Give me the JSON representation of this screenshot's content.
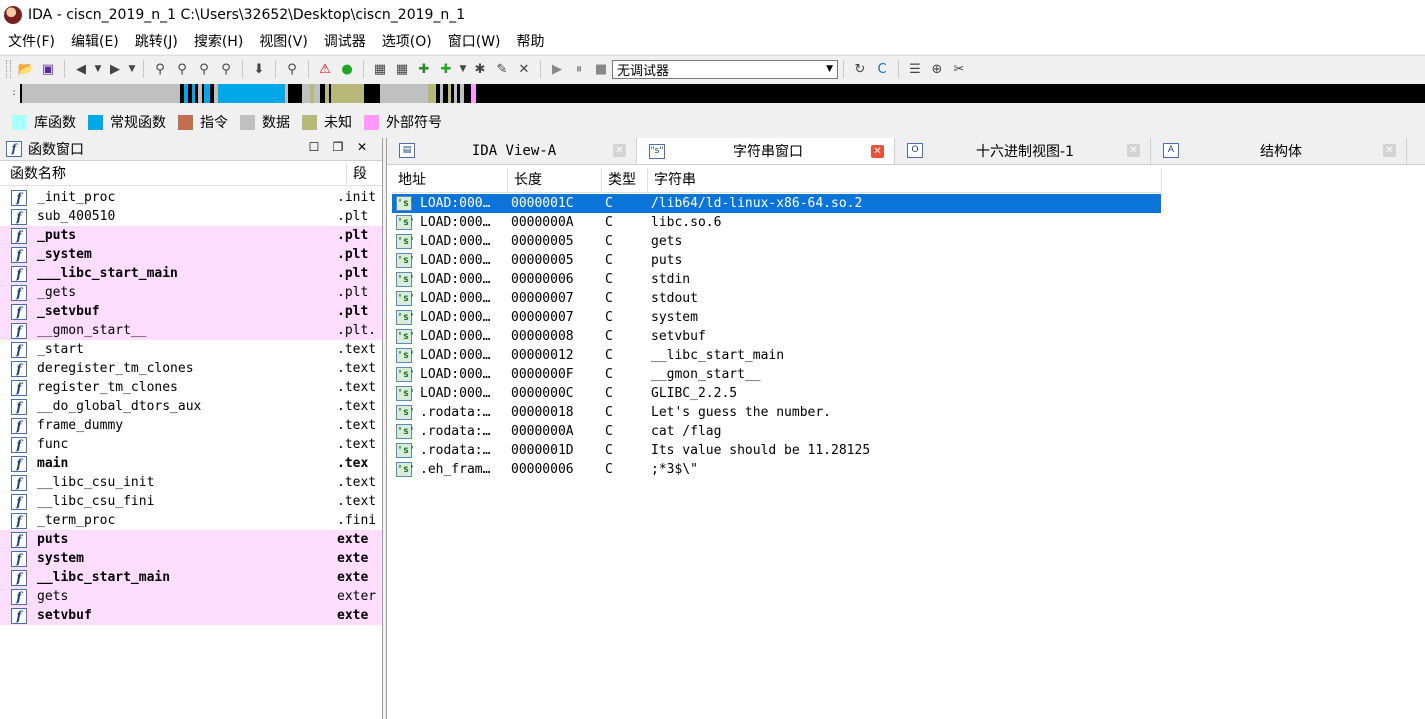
{
  "window": {
    "title": "IDA - ciscn_2019_n_1 C:\\Users\\32652\\Desktop\\ciscn_2019_n_1"
  },
  "menu": [
    "文件(F)",
    "编辑(E)",
    "跳转(J)",
    "搜索(H)",
    "视图(V)",
    "调试器",
    "选项(O)",
    "窗口(W)",
    "帮助"
  ],
  "toolbar": {
    "debugger_selected": "无调试器",
    "icons": [
      "open-icon",
      "save-icon",
      "back-icon",
      "forward-icon",
      "search-icon",
      "debug-icon",
      "run-icon"
    ]
  },
  "legend": [
    {
      "label": "库函数",
      "color": "#aaffff"
    },
    {
      "label": "常规函数",
      "color": "#00a8e8"
    },
    {
      "label": "指令",
      "color": "#c07050"
    },
    {
      "label": "数据",
      "color": "#c0c0c0"
    },
    {
      "label": "未知",
      "color": "#b8b878"
    },
    {
      "label": "外部符号",
      "color": "#ff99ff"
    }
  ],
  "functions_panel": {
    "title": "函数窗口",
    "col_name": "函数名称",
    "col_segment": "段",
    "rows": [
      {
        "name": "_init_proc",
        "seg": ".init",
        "pink": false,
        "bold": false
      },
      {
        "name": "sub_400510",
        "seg": ".plt",
        "pink": false,
        "bold": false
      },
      {
        "name": "_puts",
        "seg": ".plt",
        "pink": true,
        "bold": true
      },
      {
        "name": "_system",
        "seg": ".plt",
        "pink": true,
        "bold": true
      },
      {
        "name": "___libc_start_main",
        "seg": ".plt",
        "pink": true,
        "bold": true
      },
      {
        "name": "_gets",
        "seg": ".plt",
        "pink": true,
        "bold": false
      },
      {
        "name": "_setvbuf",
        "seg": ".plt",
        "pink": true,
        "bold": true
      },
      {
        "name": "__gmon_start__",
        "seg": ".plt.",
        "pink": true,
        "bold": false
      },
      {
        "name": "_start",
        "seg": ".text",
        "pink": false,
        "bold": false
      },
      {
        "name": "deregister_tm_clones",
        "seg": ".text",
        "pink": false,
        "bold": false
      },
      {
        "name": "register_tm_clones",
        "seg": ".text",
        "pink": false,
        "bold": false
      },
      {
        "name": "__do_global_dtors_aux",
        "seg": ".text",
        "pink": false,
        "bold": false
      },
      {
        "name": "frame_dummy",
        "seg": ".text",
        "pink": false,
        "bold": false
      },
      {
        "name": "func",
        "seg": ".text",
        "pink": false,
        "bold": false
      },
      {
        "name": "main",
        "seg": ".tex",
        "pink": false,
        "bold": true
      },
      {
        "name": "__libc_csu_init",
        "seg": ".text",
        "pink": false,
        "bold": false
      },
      {
        "name": "__libc_csu_fini",
        "seg": ".text",
        "pink": false,
        "bold": false
      },
      {
        "name": "_term_proc",
        "seg": ".fini",
        "pink": false,
        "bold": false
      },
      {
        "name": "puts",
        "seg": "exte",
        "pink": true,
        "bold": true
      },
      {
        "name": "system",
        "seg": "exte",
        "pink": true,
        "bold": true
      },
      {
        "name": "__libc_start_main",
        "seg": "exte",
        "pink": true,
        "bold": true
      },
      {
        "name": "gets",
        "seg": "exter",
        "pink": true,
        "bold": false
      },
      {
        "name": "setvbuf",
        "seg": "exte",
        "pink": true,
        "bold": true
      }
    ]
  },
  "tabs": [
    {
      "label": "IDA View-A",
      "icon": "ida-view-icon",
      "active": false,
      "mono": true
    },
    {
      "label": "字符串窗口",
      "icon": "strings-icon",
      "active": true,
      "mono": false
    },
    {
      "label": "十六进制视图-1",
      "icon": "hex-view-icon",
      "active": false,
      "mono": false
    },
    {
      "label": "结构体",
      "icon": "structures-icon",
      "active": false,
      "mono": false
    }
  ],
  "strings_panel": {
    "col_address": "地址",
    "col_length": "长度",
    "col_type": "类型",
    "col_string": "字符串",
    "rows": [
      {
        "addr": "LOAD:000…",
        "len": "0000001C",
        "type": "C",
        "str": "/lib64/ld-linux-x86-64.so.2",
        "selected": true
      },
      {
        "addr": "LOAD:000…",
        "len": "0000000A",
        "type": "C",
        "str": "libc.so.6",
        "selected": false
      },
      {
        "addr": "LOAD:000…",
        "len": "00000005",
        "type": "C",
        "str": "gets",
        "selected": false
      },
      {
        "addr": "LOAD:000…",
        "len": "00000005",
        "type": "C",
        "str": "puts",
        "selected": false
      },
      {
        "addr": "LOAD:000…",
        "len": "00000006",
        "type": "C",
        "str": "stdin",
        "selected": false
      },
      {
        "addr": "LOAD:000…",
        "len": "00000007",
        "type": "C",
        "str": "stdout",
        "selected": false
      },
      {
        "addr": "LOAD:000…",
        "len": "00000007",
        "type": "C",
        "str": "system",
        "selected": false
      },
      {
        "addr": "LOAD:000…",
        "len": "00000008",
        "type": "C",
        "str": "setvbuf",
        "selected": false
      },
      {
        "addr": "LOAD:000…",
        "len": "00000012",
        "type": "C",
        "str": "__libc_start_main",
        "selected": false
      },
      {
        "addr": "LOAD:000…",
        "len": "0000000F",
        "type": "C",
        "str": "__gmon_start__",
        "selected": false
      },
      {
        "addr": "LOAD:000…",
        "len": "0000000C",
        "type": "C",
        "str": "GLIBC_2.2.5",
        "selected": false
      },
      {
        "addr": ".rodata:…",
        "len": "00000018",
        "type": "C",
        "str": "Let's guess the number.",
        "selected": false
      },
      {
        "addr": ".rodata:…",
        "len": "0000000A",
        "type": "C",
        "str": "cat /flag",
        "selected": false
      },
      {
        "addr": ".rodata:…",
        "len": "0000001D",
        "type": "C",
        "str": "Its value should be 11.28125",
        "selected": false
      },
      {
        "addr": ".eh_fram…",
        "len": "00000006",
        "type": "C",
        "str": ";*3$\\\"",
        "selected": false
      }
    ]
  }
}
